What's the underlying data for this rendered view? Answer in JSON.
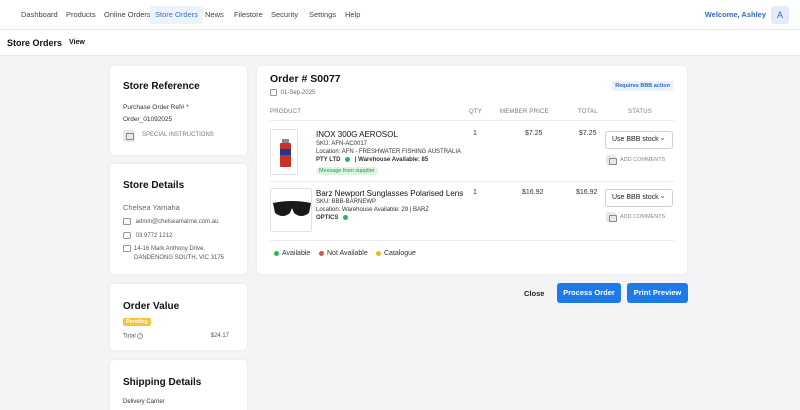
{
  "nav": {
    "items": [
      "Dashboard",
      "Products",
      "Online Orders",
      "Store Orders",
      "News",
      "Filestore",
      "Security",
      "Settings",
      "Help"
    ],
    "active": "Store Orders",
    "welcome": "Welcome, Ashley",
    "avatar_initial": "A"
  },
  "subbar": {
    "title": "Store Orders",
    "view": "View"
  },
  "store_reference": {
    "title": "Store Reference",
    "po_label": "Purchase Order Ref# *",
    "po_value": "Order_01092025",
    "special_instructions": "SPECIAL INSTRUCTIONS"
  },
  "store_details": {
    "title": "Store Details",
    "name": "Chelsea Yamaha",
    "email": "admin@chelseamarine.com.au",
    "phone": "03 9772 1212",
    "address_line1": "14-16 Mark Anthony Drive,",
    "address_line2": "DANDENONG SOUTH, VIC 3175"
  },
  "order_value": {
    "title": "Order Value",
    "status": "Pending",
    "total_label": "Total",
    "total_value": "$24.17"
  },
  "shipping": {
    "title": "Shipping Details",
    "carrier_label": "Delivery Carrier"
  },
  "order": {
    "title": "Order # S0077",
    "date": "01-Sep-2025",
    "badge": "Requires BBB action",
    "headers": {
      "product": "PRODUCT",
      "qty": "QTY",
      "member_price": "MEMBER PRICE",
      "total": "TOTAL",
      "status": "STATUS"
    },
    "lines": [
      {
        "name": "INOX 300G AEROSOL",
        "sku": "SKU:  AFN-AC0017",
        "location_a": "Location: AFN - FRESHWATER FISHING AUSTRALIA",
        "location_b": "PTY LTD",
        "warehouse": "| Warehouse Available: 85",
        "message": "Message from supplier",
        "qty": "1",
        "price": "$7.25",
        "total": "$7.25",
        "status": "Use BBB stock",
        "comments": "ADD COMMENTS"
      },
      {
        "name": "Barz Newport Sunglasses Polarised Lens",
        "sku": "SKU:  BBB-BARNEWP",
        "location_a": "Location: Warehouse Available: 29 | BARZ",
        "location_b": "OPTICS",
        "qty": "1",
        "price": "$16.92",
        "total": "$16.92",
        "status": "Use BBB stock",
        "comments": "ADD COMMENTS"
      }
    ],
    "legend": [
      {
        "label": "Available",
        "color": "#2fb35a"
      },
      {
        "label": "Not Available",
        "color": "#d9534f"
      },
      {
        "label": "Catalogue",
        "color": "#f0b429"
      }
    ]
  },
  "actions": {
    "close": "Close",
    "process": "Process Order",
    "print": "Print Preview"
  }
}
